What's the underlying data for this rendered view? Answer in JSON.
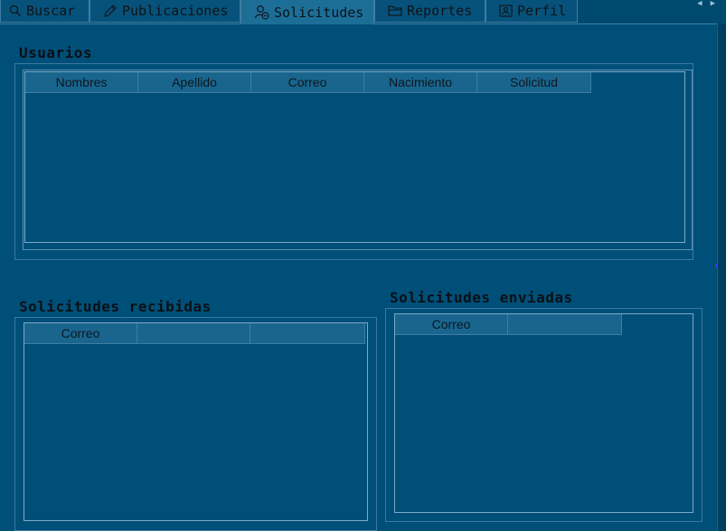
{
  "tabs": [
    {
      "label": "Buscar",
      "icon": "search-icon",
      "active": false
    },
    {
      "label": "Publicaciones",
      "icon": "pencil-icon",
      "active": false
    },
    {
      "label": "Solicitudes",
      "icon": "user-request-icon",
      "active": true
    },
    {
      "label": "Reportes",
      "icon": "folder-icon",
      "active": false
    },
    {
      "label": "Perfil",
      "icon": "profile-card-icon",
      "active": false
    }
  ],
  "usuarios": {
    "title": "Usuarios",
    "columns": [
      "Nombres",
      "Apellido",
      "Correo",
      "Nacimiento",
      "Solicitud"
    ],
    "rows": []
  },
  "recibidas": {
    "title": "Solicitudes recibidas",
    "columns": [
      "Correo",
      "",
      ""
    ],
    "rows": []
  },
  "enviadas": {
    "title": "Solicitudes enviadas",
    "columns": [
      "Correo",
      ""
    ],
    "rows": []
  },
  "colors": {
    "background": "#004f79",
    "header": "#19658d",
    "active_tab": "#1d6e97"
  }
}
